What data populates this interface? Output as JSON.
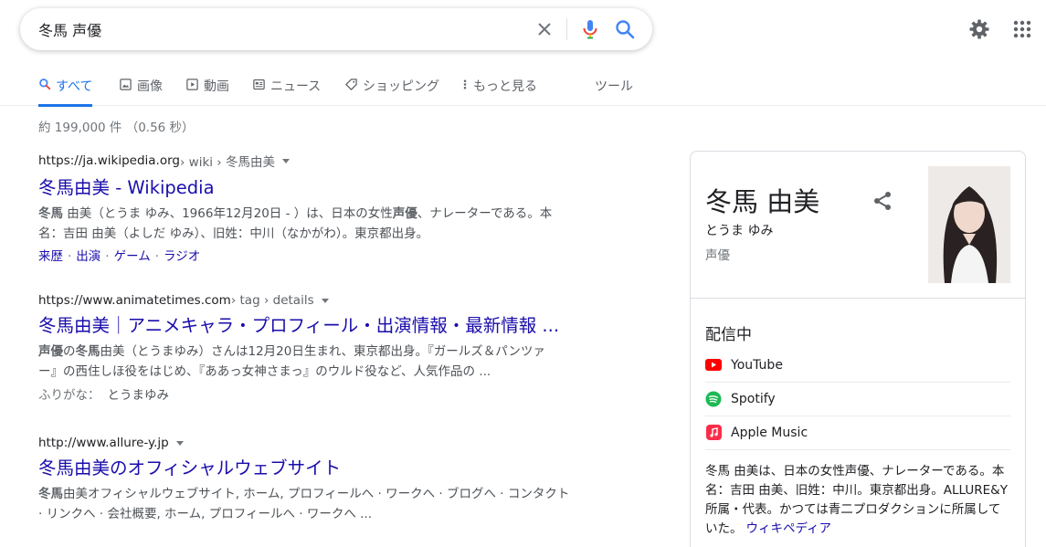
{
  "search": {
    "query": "冬馬 声優",
    "placeholder": ""
  },
  "tabs": [
    {
      "label": "すべて",
      "icon": "search-icon",
      "active": true
    },
    {
      "label": "画像",
      "icon": "image-icon"
    },
    {
      "label": "動画",
      "icon": "video-icon"
    },
    {
      "label": "ニュース",
      "icon": "news-icon"
    },
    {
      "label": "ショッピング",
      "icon": "tag-icon"
    },
    {
      "label": "もっと見る",
      "icon": "more-vert-icon"
    },
    {
      "label": "ツール"
    }
  ],
  "result_stats": "約 199,000 件 （0.56 秒）",
  "results": [
    {
      "url_base": "https://ja.wikipedia.org",
      "url_crumb": " › wiki › 冬馬由美",
      "title": "冬馬由美 - Wikipedia",
      "snippet_lines": [
        [
          "冬馬",
          " 由美（とうま ゆみ、1966年12月20日 - ）は、日本の女性",
          "声優",
          "、ナレーターである。本"
        ],
        [
          "",
          "名：吉田 由美（よしだ ゆみ）、旧姓：中川（なかがわ）。東京都出身。",
          "",
          ""
        ]
      ],
      "links": [
        "来歴",
        "出演",
        "ゲーム",
        "ラジオ"
      ]
    },
    {
      "url_base": "https://www.animatetimes.com",
      "url_crumb": " › tag › details",
      "title": "冬馬由美｜アニメキャラ・プロフィール・出演情報・最新情報 ...",
      "snippet_lines": [
        [
          "声優",
          "の",
          "冬馬",
          "由美（とうまゆみ）さんは12月20日生まれ、東京都出身。『ガールズ＆パンツァ"
        ],
        [
          "",
          "ー』の西住しほ役をはじめ、『ああっ女神さまっ』のウルド役など、人気作品の ...",
          "",
          ""
        ]
      ],
      "extra_label": "ふりがな：",
      "extra_value": "とうまゆみ"
    },
    {
      "url_base": "http://www.allure-y.jp",
      "url_crumb": "",
      "title": "冬馬由美のオフィシャルウェブサイト",
      "snippet_lines": [
        [
          "冬馬",
          "由美オフィシャルウェブサイト, ホーム, プロフィールへ · ワークへ · ブログへ · コンタクト",
          "",
          ""
        ],
        [
          "",
          "· リンクへ · 会社概要, ホーム, プロフィールへ · ワークへ ...",
          "",
          ""
        ]
      ]
    }
  ],
  "knowledge_panel": {
    "title": "冬馬 由美",
    "reading": "とうま ゆみ",
    "type": "声優",
    "streaming_heading": "配信中",
    "services": [
      {
        "label": "YouTube",
        "icon": "youtube-icon",
        "color": "#ff0000"
      },
      {
        "label": "Spotify",
        "icon": "spotify-icon",
        "color": "#1db954"
      },
      {
        "label": "Apple Music",
        "icon": "apple-music-icon",
        "color": "#fa2d48"
      }
    ],
    "description": "冬馬 由美は、日本の女性声優、ナレーターである。本名：吉田 由美、旧姓：中川。東京都出身。ALLURE&Y所属・代表。かつては青二プロダクションに所属していた。",
    "description_link": "ウィキペディア"
  },
  "colors": {
    "link": "#1a0dab",
    "accent": "#1a73e8",
    "muted": "#70757a"
  }
}
